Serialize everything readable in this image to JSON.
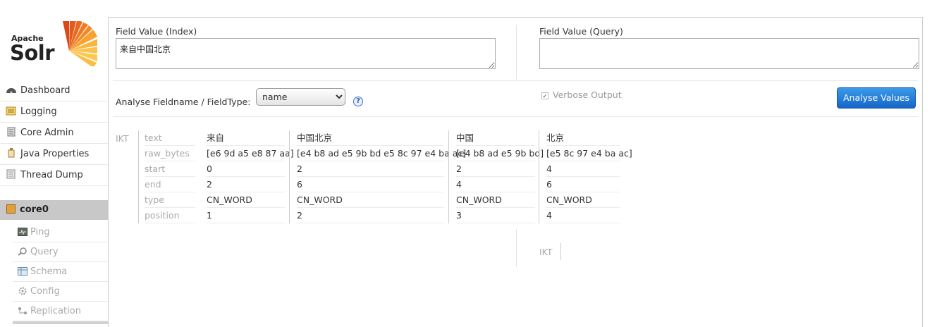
{
  "logo": {
    "apache": "Apache",
    "solr": "Solr"
  },
  "sidebar": {
    "items": [
      {
        "label": "Dashboard"
      },
      {
        "label": "Logging"
      },
      {
        "label": "Core Admin"
      },
      {
        "label": "Java Properties"
      },
      {
        "label": "Thread Dump"
      }
    ],
    "core": {
      "name": "core0",
      "items": [
        {
          "label": "Ping"
        },
        {
          "label": "Query"
        },
        {
          "label": "Schema"
        },
        {
          "label": "Config"
        },
        {
          "label": "Replication"
        }
      ]
    }
  },
  "analysis": {
    "index_label": "Field Value (Index)",
    "index_value": "来自中国北京",
    "query_label": "Field Value (Query)",
    "query_value": "",
    "fieldtype_label": "Analyse Fieldname / FieldType:",
    "fieldtype_value": "name",
    "help_glyph": "?",
    "verbose_label": "Verbose Output",
    "verbose_checked": true,
    "analyse_button": "Analyse Values"
  },
  "results": {
    "index_tokenizer": "IKT",
    "query_tokenizer": "IKT",
    "properties": [
      "text",
      "raw_bytes",
      "start",
      "end",
      "type",
      "position"
    ],
    "tokens": [
      {
        "text": "来自",
        "raw_bytes": "[e6 9d a5 e8 87 aa]",
        "start": "0",
        "end": "2",
        "type": "CN_WORD",
        "position": "1"
      },
      {
        "text": "中国北京",
        "raw_bytes": "[e4 b8 ad e5 9b bd e5 8c 97 e4 ba ac]",
        "start": "2",
        "end": "6",
        "type": "CN_WORD",
        "position": "2"
      },
      {
        "text": "中国",
        "raw_bytes": "[e4 b8 ad e5 9b bd]",
        "start": "2",
        "end": "4",
        "type": "CN_WORD",
        "position": "3"
      },
      {
        "text": "北京",
        "raw_bytes": "[e5 8c 97 e4 ba ac]",
        "start": "4",
        "end": "6",
        "type": "CN_WORD",
        "position": "4"
      }
    ]
  },
  "colors": {
    "accent": "#1a6fd0",
    "core_header_bg": "#c8c8c8"
  }
}
